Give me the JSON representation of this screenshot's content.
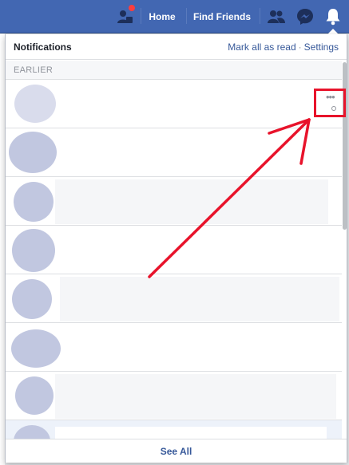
{
  "topbar": {
    "home_label": "Home",
    "find_friends_label": "Find Friends"
  },
  "panel": {
    "title": "Notifications",
    "mark_all_read": "Mark all as read",
    "separator": "·",
    "settings": "Settings",
    "section_label": "EARLIER",
    "see_all": "See All"
  },
  "colors": {
    "brand": "#4267b2",
    "link": "#365899",
    "badge": "#fa3e3e",
    "annotation": "#e8132b"
  }
}
